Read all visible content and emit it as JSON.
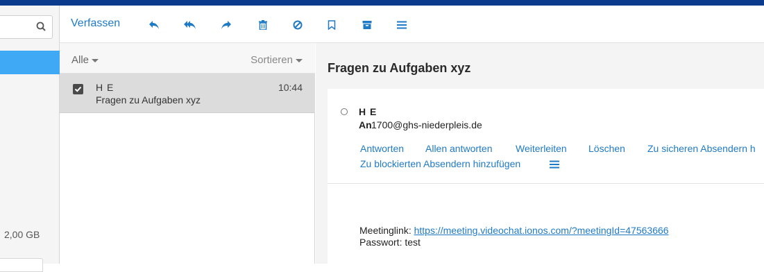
{
  "sidebar": {
    "storage_label": "2,00 GB"
  },
  "toolbar": {
    "compose_label": "Verfassen",
    "icons": [
      "reply-icon",
      "reply-all-icon",
      "forward-icon",
      "trash-icon",
      "block-icon",
      "bookmark-icon",
      "archive-icon",
      "menu-icon"
    ]
  },
  "list": {
    "filter_label": "Alle",
    "sort_label": "Sortieren",
    "messages": [
      {
        "from": "H E",
        "subject": "Fragen zu Aufgaben xyz",
        "time": "10:44",
        "checked": true
      }
    ]
  },
  "reader": {
    "subject": "Fragen zu Aufgaben xyz",
    "sender": "H E",
    "to_label": "An",
    "to_address": "1700@ghs-niederpleis.de",
    "actions": [
      "Antworten",
      "Allen antworten",
      "Weiterleiten",
      "Löschen",
      "Zu sicheren Absendern h",
      "Zu blockierten Absendern hinzufügen"
    ],
    "body_label_1": "Meetinglink:",
    "body_link": "https://meeting.videochat.ionos.com/?meetingId=47563666",
    "body_line_2": "Passwort: test"
  },
  "colors": {
    "accent": "#1f7ac6",
    "topbar": "#0b3b8c",
    "sidebar_active": "#3fa9f5"
  }
}
